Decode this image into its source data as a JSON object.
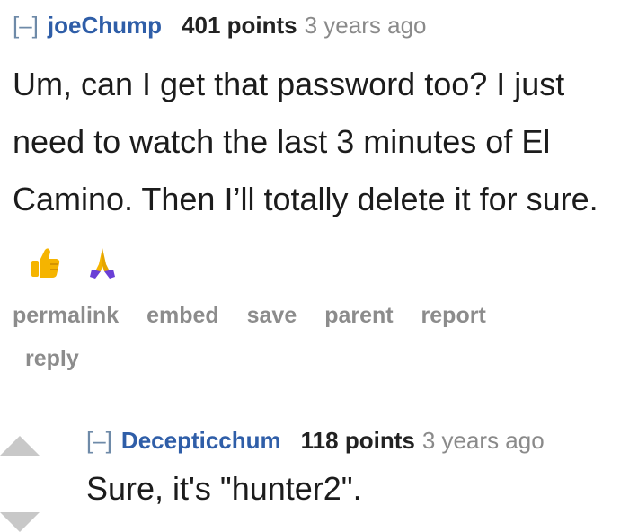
{
  "comment1": {
    "expand_label": "[–]",
    "author": "joeChump",
    "score": "401 points",
    "time": "3 years ago",
    "body": "Um, can I get that password too? I just need to watch the last 3 minutes of El Camino. Then I’ll totally delete it for sure.",
    "emojis": [
      "thumbs-up-emoji",
      "praying-hands-emoji"
    ],
    "buttons": {
      "permalink": "permalink",
      "embed": "embed",
      "save": "save",
      "parent": "parent",
      "report": "report",
      "reply": "reply"
    }
  },
  "comment2": {
    "expand_label": "[–]",
    "author": "Decepticchum",
    "score": "118 points",
    "time": "3 years ago",
    "body": "Sure, it's \"hunter2\"."
  },
  "colors": {
    "author": "#2f5ea8",
    "muted": "#8a8a8a",
    "arrow": "#c8c8c8",
    "emoji_yellow": "#f5b400",
    "emoji_purple": "#6a3fd6"
  }
}
